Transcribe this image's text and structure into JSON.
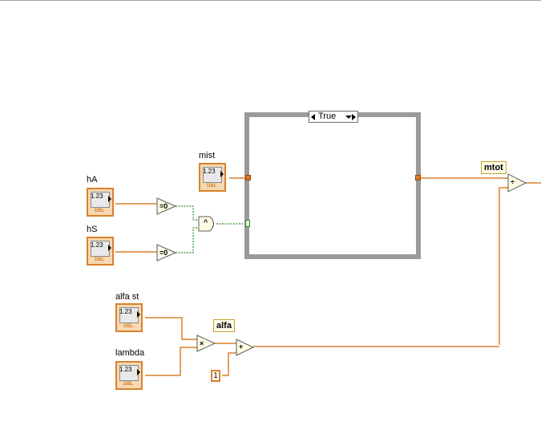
{
  "controls": {
    "hA": {
      "label": "hA",
      "value": "1.23",
      "type": "DBL"
    },
    "hS": {
      "label": "hS",
      "value": "1.23",
      "type": "DBL"
    },
    "mist": {
      "label": "mist",
      "value": "1.23",
      "type": "DBL"
    },
    "alfa_st": {
      "label": "alfa st",
      "value": "1.23",
      "type": "DBL"
    },
    "lambda": {
      "label": "lambda",
      "value": "1.23",
      "type": "DBL"
    }
  },
  "case_structure": {
    "selector_value": "True"
  },
  "wire_labels": {
    "alfa": "alfa",
    "mtot": "mtot"
  },
  "constant": {
    "value": "1"
  },
  "functions": {
    "eq0_a": "=0",
    "eq0_b": "=0",
    "and": "^",
    "multiply": "×",
    "add": "+",
    "divide": "÷"
  },
  "colors": {
    "numeric_wire": "#d9822b",
    "boolean_wire": "#2a8a2a",
    "control_fill": "#f6d9b3"
  }
}
